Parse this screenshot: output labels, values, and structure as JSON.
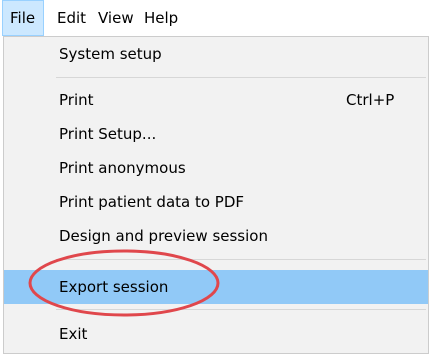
{
  "menubar": {
    "items": [
      {
        "label": "File"
      },
      {
        "label": "Edit"
      },
      {
        "label": "View"
      },
      {
        "label": "Help"
      }
    ]
  },
  "file_menu": {
    "items": [
      {
        "label": "System setup",
        "shortcut": ""
      },
      {
        "label": "Print",
        "shortcut": "Ctrl+P"
      },
      {
        "label": "Print Setup...",
        "shortcut": ""
      },
      {
        "label": "Print anonymous",
        "shortcut": ""
      },
      {
        "label": "Print patient data to PDF",
        "shortcut": ""
      },
      {
        "label": "Design and preview session",
        "shortcut": ""
      },
      {
        "label": "Export session",
        "shortcut": "",
        "highlighted": true
      },
      {
        "label": "Exit",
        "shortcut": ""
      }
    ]
  },
  "colors": {
    "menu_background": "#f2f2f2",
    "highlight": "#91c9f7",
    "active_menubar": "#cce8ff",
    "annotation_circle": "#e0474c"
  }
}
